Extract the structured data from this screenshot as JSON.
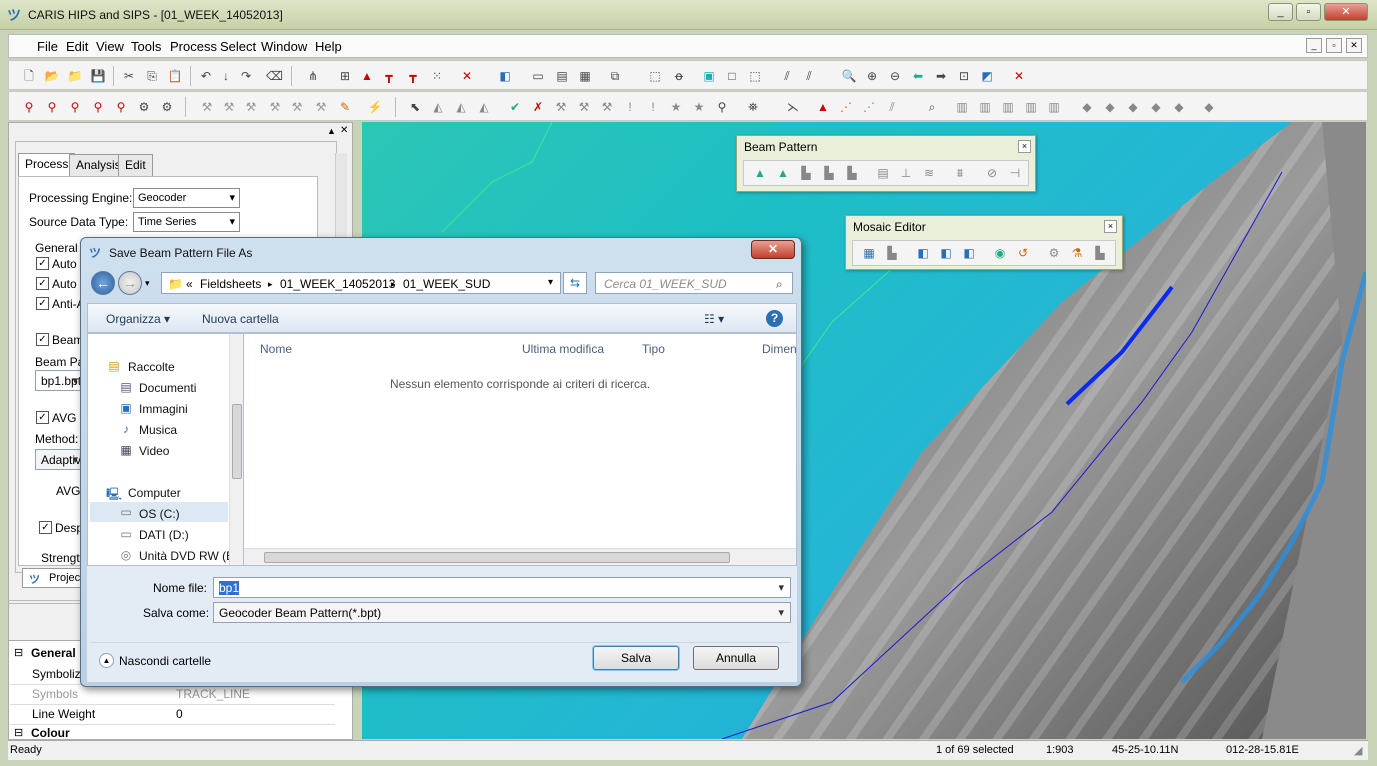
{
  "window": {
    "title": "CARIS HIPS and SIPS - [01_WEEK_14052013]",
    "min": "_",
    "restore": "▫",
    "close": "✕"
  },
  "menu": [
    "File",
    "Edit",
    "View",
    "Tools",
    "Process",
    "Select",
    "Window",
    "Help"
  ],
  "left_panel": {
    "tabs": [
      "Process",
      "Analysis",
      "Edit"
    ],
    "processing_engine_label": "Processing Engine:",
    "processing_engine_value": "Geocoder",
    "source_type_label": "Source Data Type:",
    "source_type_value": "Time Series",
    "general_label": "General C",
    "checks": [
      "Auto C",
      "Auto T",
      "Anti-A"
    ],
    "beam_label": "Beam",
    "beam_pat_label": "Beam Pat",
    "beam_pat_value": "bp1.bpt",
    "avg_label": "AVG C",
    "method_label": "Method:",
    "method_value": "Adaptive",
    "avg2": "AVG",
    "desp_label": "Desp",
    "strength_label": "Strengt",
    "project_tab": "Project"
  },
  "properties": {
    "general": "General",
    "rows": [
      {
        "name": "Symboliz",
        "value": ""
      },
      {
        "name": "Symbols",
        "value": "TRACK_LINE"
      },
      {
        "name": "Line Weight",
        "value": "0"
      }
    ],
    "colour": "Colour"
  },
  "beam_pattern": {
    "title": "Beam Pattern",
    "close": "×"
  },
  "mosaic_editor": {
    "title": "Mosaic Editor",
    "close": "×"
  },
  "dialog": {
    "title": "Save Beam Pattern File As",
    "close": "✕",
    "breadcrumb": [
      "«",
      "Fieldsheets",
      "01_WEEK_14052013",
      "01_WEEK_SUD"
    ],
    "search_placeholder": "Cerca 01_WEEK_SUD",
    "organize": "Organizza ▾",
    "new_folder": "Nuova cartella",
    "tree": [
      {
        "label": "Raccolte",
        "icon": "library-icon"
      },
      {
        "label": "Documenti",
        "icon": "documents-icon"
      },
      {
        "label": "Immagini",
        "icon": "pictures-icon"
      },
      {
        "label": "Musica",
        "icon": "music-icon"
      },
      {
        "label": "Video",
        "icon": "video-icon"
      },
      {
        "label": "Computer",
        "icon": "computer-icon"
      },
      {
        "label": "OS (C:)",
        "icon": "drive-icon"
      },
      {
        "label": "DATI (D:)",
        "icon": "drive-icon"
      },
      {
        "label": "Unità DVD RW (E",
        "icon": "dvd-icon"
      }
    ],
    "columns": [
      "Nome",
      "Ultima modifica",
      "Tipo",
      "Dimen"
    ],
    "empty_message": "Nessun elemento corrisponde ai criteri di ricerca.",
    "filename_label": "Nome file:",
    "filename_value": "bp1",
    "savetype_label": "Salva come:",
    "savetype_value": "Geocoder Beam Pattern(*.bpt)",
    "hide_folders": "Nascondi cartelle",
    "save": "Salva",
    "cancel": "Annulla"
  },
  "status": {
    "ready": "Ready",
    "selected": "1 of 69 selected",
    "scale": "1:903",
    "lat": "45-25-10.11N",
    "lon": "012-28-15.81E"
  }
}
